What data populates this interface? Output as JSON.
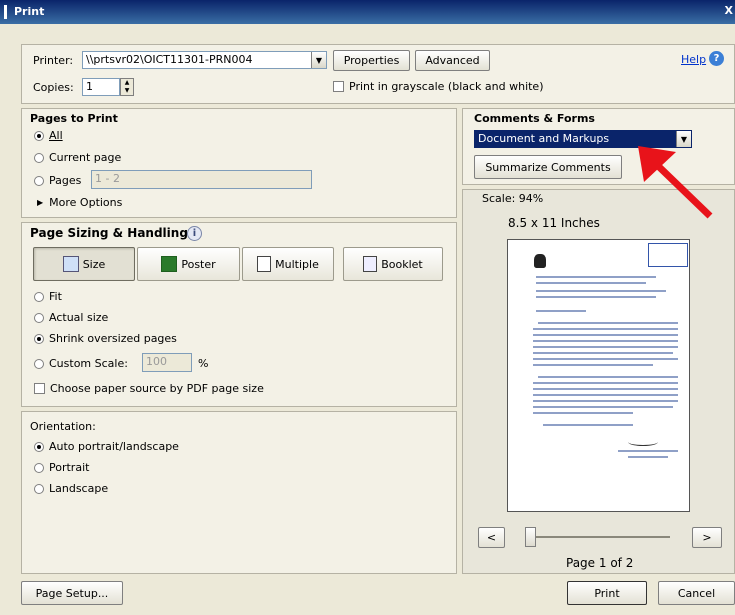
{
  "window": {
    "title": "Print",
    "close_glyph": "X"
  },
  "printer": {
    "label": "Printer:",
    "value": "\\\\prtsvr02\\OICT11301-PRN004",
    "properties_label": "Properties",
    "advanced_label": "Advanced",
    "help_label": "Help"
  },
  "copies": {
    "label": "Copies:",
    "value": "1",
    "grayscale_label": "Print in grayscale (black and white)"
  },
  "pages_to_print": {
    "header": "Pages to Print",
    "all_label": "All",
    "current_label": "Current page",
    "pages_label": "Pages",
    "pages_value": "1 - 2",
    "more_options_label": "More Options",
    "selected": "All"
  },
  "sizing": {
    "header": "Page Sizing & Handling",
    "buttons": [
      "Size",
      "Poster",
      "Multiple",
      "Booklet"
    ],
    "active": "Size",
    "fit_label": "Fit",
    "actual_label": "Actual size",
    "shrink_label": "Shrink oversized pages",
    "custom_label": "Custom Scale:",
    "custom_value": "100",
    "percent": "%",
    "paper_source_label": "Choose paper source by PDF page size",
    "selected": "Shrink oversized pages"
  },
  "orientation": {
    "header": "Orientation:",
    "auto_label": "Auto portrait/landscape",
    "portrait_label": "Portrait",
    "landscape_label": "Landscape",
    "selected": "Auto portrait/landscape"
  },
  "comments_forms": {
    "header": "Comments & Forms",
    "value": "Document and Markups",
    "summarize_label": "Summarize Comments"
  },
  "preview": {
    "scale_label": "Scale:  94%",
    "paper_size": "8.5 x 11 Inches",
    "page_indicator": "Page 1 of 2",
    "prev": "<",
    "next": ">"
  },
  "footer": {
    "page_setup_label": "Page Setup...",
    "print_label": "Print",
    "cancel_label": "Cancel"
  },
  "colors": {
    "title_bar": "#0a246a",
    "selection": "#0a246a",
    "arrow": "#e8131a",
    "link": "#0033cc"
  }
}
